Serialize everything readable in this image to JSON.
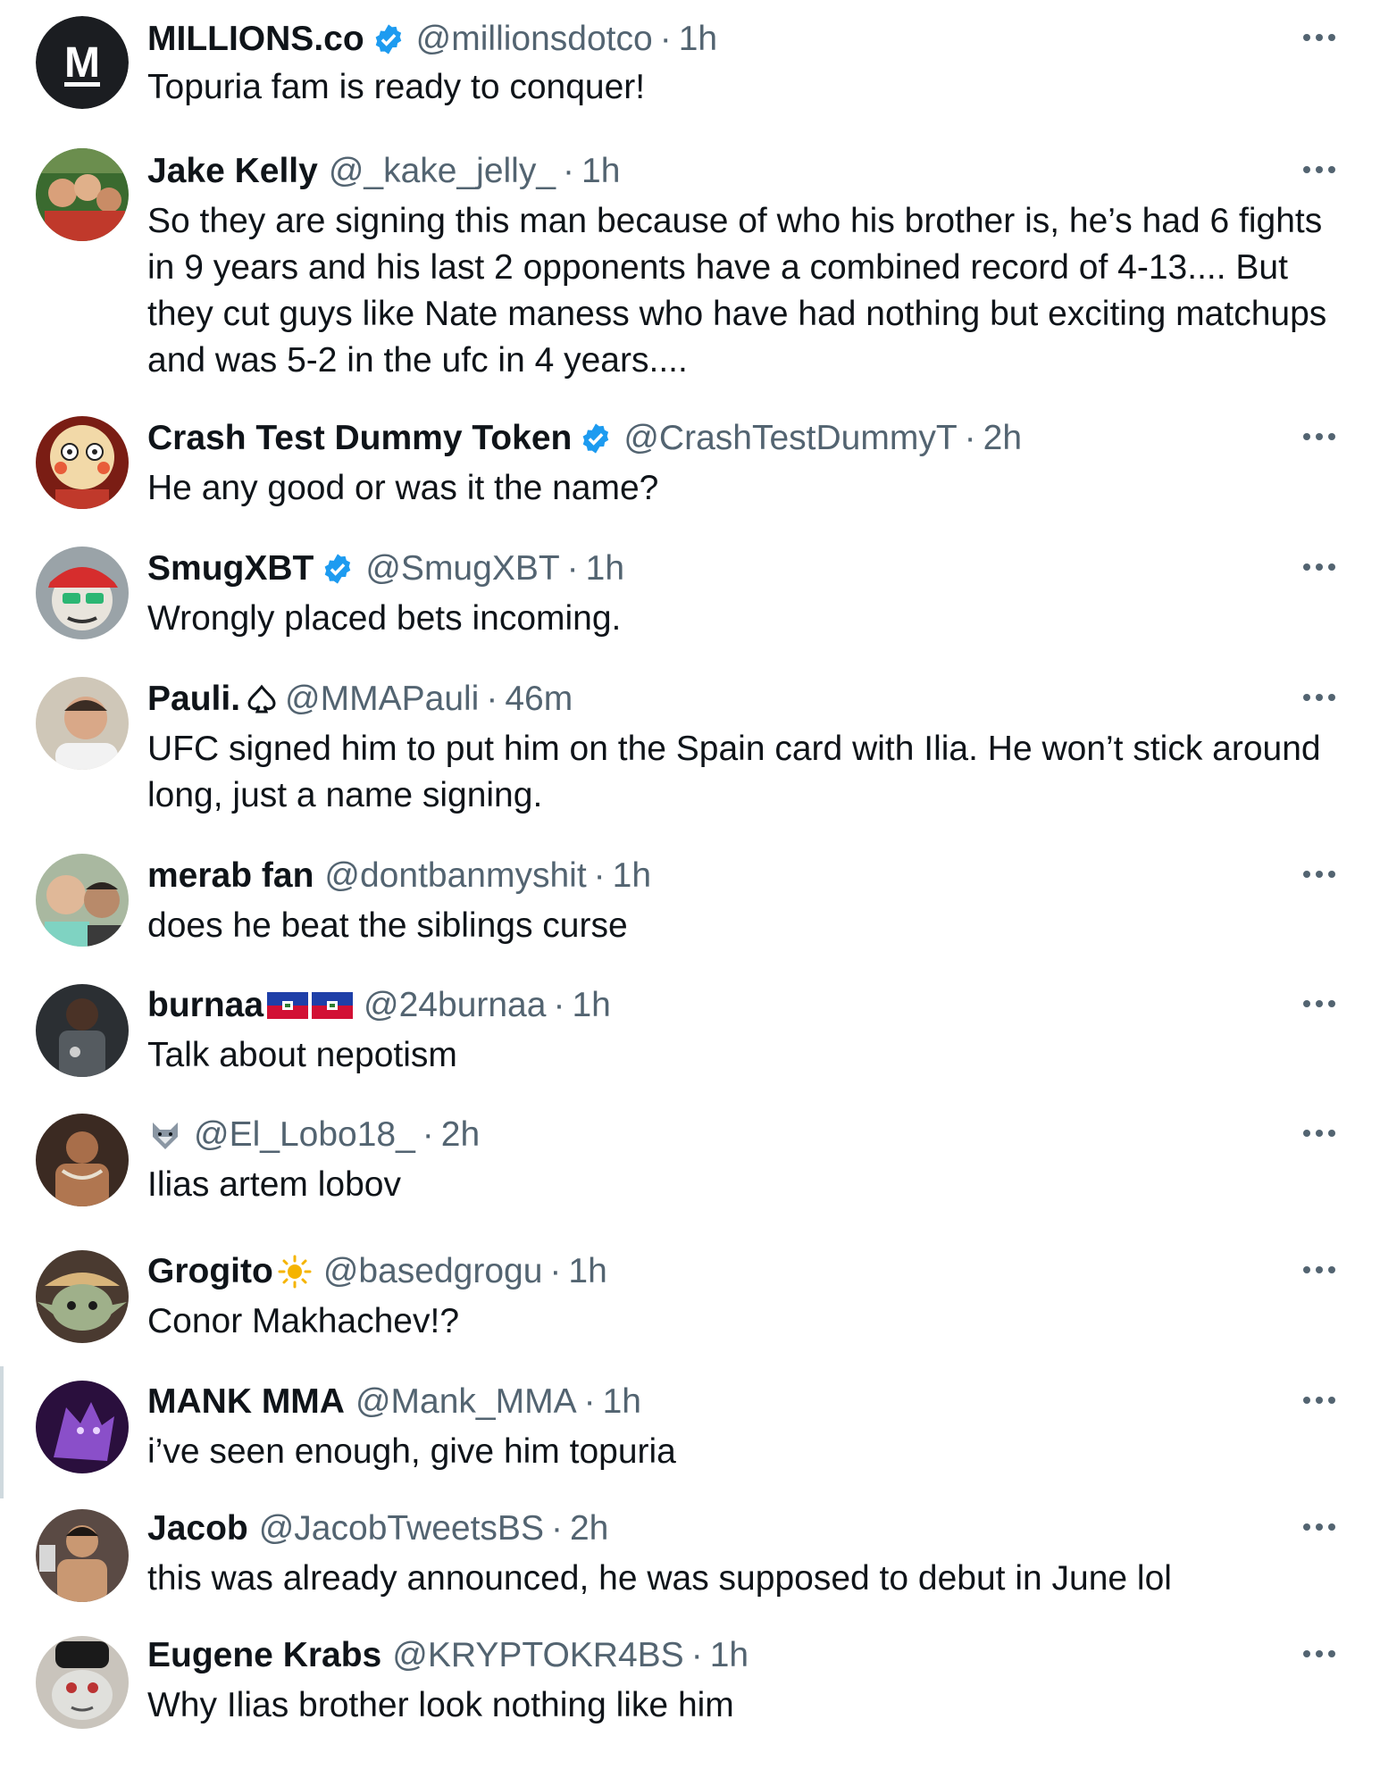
{
  "replies": [
    {
      "name": "MILLIONS.co",
      "verified": true,
      "handle": "@millionsdotco",
      "sep": "·",
      "time": "1h",
      "text": "Topuria fam is ready to conquer!",
      "avatar_icon": "millions-logo-avatar"
    },
    {
      "name": "Jake Kelly",
      "verified": false,
      "handle": "@_kake_jelly_",
      "sep": "·",
      "time": "1h",
      "text": "So they are signing this man because of who his brother is, he’s had 6 fights in 9 years and his last 2 opponents have a combined record of 4-13.... But they cut guys like Nate maness who have had nothing but exciting matchups and was 5-2 in the ufc in 4 years....",
      "avatar_icon": "group-photo-avatar"
    },
    {
      "name": "Crash Test Dummy Token",
      "verified": true,
      "handle": "@CrashTestDummyT",
      "sep": "·",
      "time": "2h",
      "text": "He any good or was it the name?",
      "avatar_icon": "crash-dummy-avatar"
    },
    {
      "name": "SmugXBT",
      "verified": true,
      "handle": "@SmugXBT",
      "sep": "·",
      "time": "1h",
      "text": "Wrongly placed bets incoming.",
      "avatar_icon": "cartoon-cap-avatar"
    },
    {
      "name": "Pauli.",
      "name_icon": "spade-outline-icon",
      "verified": false,
      "handle": "@MMAPauli",
      "sep": "·",
      "time": "46m",
      "text": "UFC signed him to put him on the Spain card with Ilia. He won’t stick around long, just a name signing.",
      "avatar_icon": "man-selfie-avatar"
    },
    {
      "name": "merab fan",
      "verified": false,
      "handle": "@dontbanmyshit",
      "sep": "·",
      "time": "1h",
      "text": "does he beat the siblings curse",
      "avatar_icon": "two-men-avatar"
    },
    {
      "name": "burnaa",
      "name_icon": "haiti-flag-icon",
      "verified": false,
      "handle": "@24burnaa",
      "sep": "·",
      "time": "1h",
      "text": "Talk about nepotism",
      "avatar_icon": "athlete-avatar"
    },
    {
      "name": "",
      "name_icon": "wolf-emoji-icon",
      "verified": false,
      "handle": "@El_Lobo18_",
      "sep": "·",
      "time": "2h",
      "text": "Ilias artem lobov",
      "avatar_icon": "fighter-avatar"
    },
    {
      "name": "Grogito",
      "name_icon": "sun-emoji-icon",
      "verified": false,
      "handle": "@basedgrogu",
      "sep": "·",
      "time": "1h",
      "text": "Conor Makhachev!?",
      "avatar_icon": "grogu-avatar"
    },
    {
      "name": "MANK MMA",
      "verified": false,
      "handle": "@Mank_MMA",
      "sep": "·",
      "time": "1h",
      "text": "i’ve seen enough, give him topuria",
      "avatar_icon": "purple-wolf-avatar"
    },
    {
      "name": "Jacob",
      "verified": false,
      "handle": "@JacobTweetsBS",
      "sep": "·",
      "time": "2h",
      "text": "this was already announced, he was supposed to debut in June lol",
      "avatar_icon": "boxer-avatar"
    },
    {
      "name": "Eugene Krabs",
      "verified": false,
      "handle": "@KRYPTOKR4BS",
      "sep": "·",
      "time": "1h",
      "text": "Why Ilias brother look nothing like him",
      "avatar_icon": "crab-cap-avatar"
    }
  ],
  "colors": {
    "verified": "#1d9bf0",
    "secondary": "#536471",
    "primary": "#0f1419"
  }
}
